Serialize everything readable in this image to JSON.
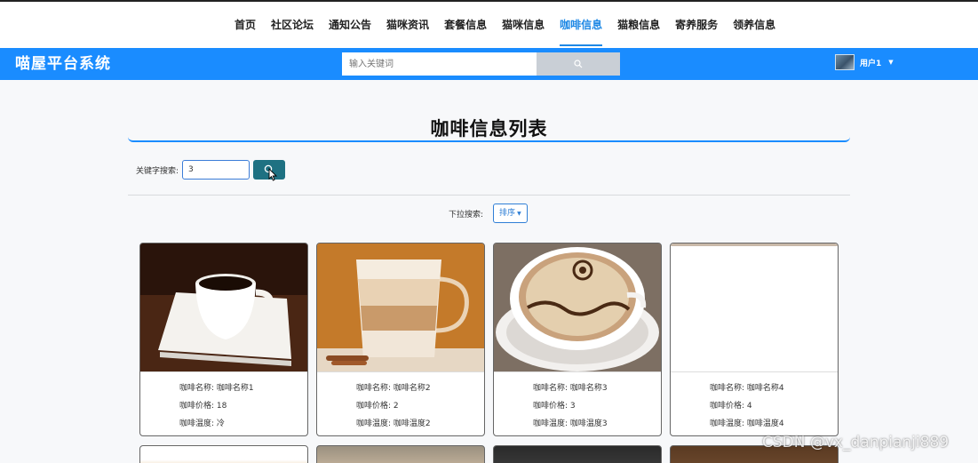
{
  "nav": {
    "items": [
      "首页",
      "社区论坛",
      "通知公告",
      "猫咪资讯",
      "套餐信息",
      "猫咪信息",
      "咖啡信息",
      "猫粮信息",
      "寄养服务",
      "领养信息"
    ],
    "active_index": 6
  },
  "header": {
    "brand": "喵屋平台系统",
    "search_placeholder": "输入关键词",
    "username": "用户1"
  },
  "page": {
    "title": "咖啡信息列表",
    "keyword_label": "关键字搜索:",
    "keyword_value": "3",
    "dropdown_label": "下拉搜索:",
    "sort_label": "排序"
  },
  "cards": [
    {
      "name_label": "咖啡名称:",
      "name": "咖啡名称1",
      "price_label": "咖啡价格:",
      "price": "18",
      "temp_label": "咖啡温度:",
      "temp": "冷"
    },
    {
      "name_label": "咖啡名称:",
      "name": "咖啡名称2",
      "price_label": "咖啡价格:",
      "price": "2",
      "temp_label": "咖啡温度:",
      "temp": "咖啡温度2"
    },
    {
      "name_label": "咖啡名称:",
      "name": "咖啡名称3",
      "price_label": "咖啡价格:",
      "price": "3",
      "temp_label": "咖啡温度:",
      "temp": "咖啡温度3"
    },
    {
      "name_label": "咖啡名称:",
      "name": "咖啡名称4",
      "price_label": "咖啡价格:",
      "price": "4",
      "temp_label": "咖啡温度:",
      "temp": "咖啡温度4"
    }
  ],
  "watermark": "CSDN @vx_danpianji889",
  "colors": {
    "accent": "#1a8cff",
    "search_button": "#1e7182"
  }
}
